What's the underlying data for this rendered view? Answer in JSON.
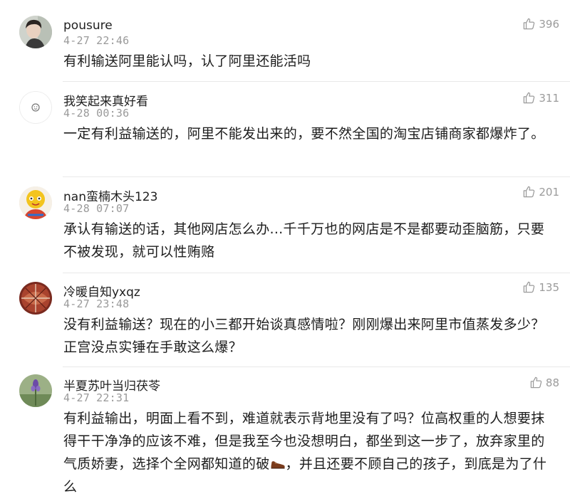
{
  "comments": [
    {
      "user": "pousure",
      "time": "4-27 22:46",
      "likes": "396",
      "text": "有利输送阿里能认吗，认了阿里还能活吗"
    },
    {
      "user": "我笑起来真好看",
      "time": "4-28 00:36",
      "likes": "311",
      "text": "一定有利益输送的，阿里不能发出来的，要不然全国的淘宝店铺商家都爆炸了。"
    },
    {
      "user": "nan蛮楠木头123",
      "time": "4-28 07:07",
      "likes": "201",
      "text": "承认有输送的话，其他网店怎么办...千千万也的网店是不是都要动歪脑筋，只要不被发现，就可以性贿赂"
    },
    {
      "user": "冷暖自知yxqz",
      "time": "4-27 23:48",
      "likes": "135",
      "text": "没有利益输送？现在的小三都开始谈真感情啦？刚刚爆出来阿里市值蒸发多少？正宫没点实锤在手敢这么爆？"
    },
    {
      "user": "半夏苏叶当归茯苓",
      "time": "4-27 22:31",
      "likes": "88",
      "text_before_emoji": "有利益输出，明面上看不到，难道就表示背地里没有了吗？位高权重的人想要抹得干干净净的应该不难，但是我至今也没想明白，都坐到这一步了，放弃家里的气质娇妻，选择个全网都知道的破",
      "emoji": "shoe-emoji",
      "text_after_emoji": "，并且还要不顾自己的孩子，到底是为了什么"
    }
  ],
  "icons": {
    "like": "thumbs-up-outline-icon"
  },
  "colors": {
    "meta_gray": "#9a9a9a",
    "text": "#1d1d1d",
    "divider": "#e9e9e9"
  }
}
